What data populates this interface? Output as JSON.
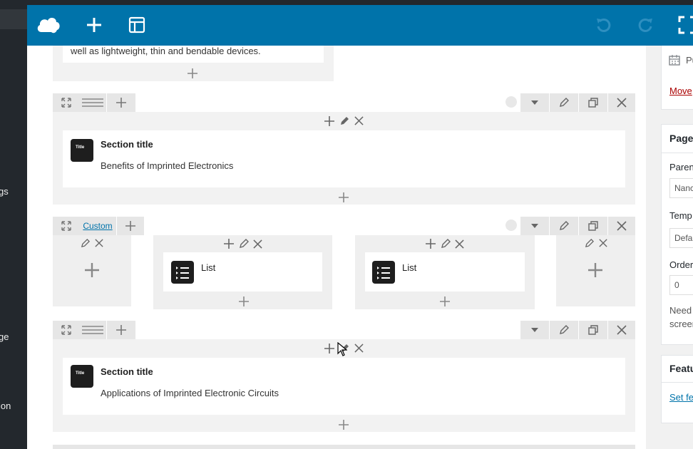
{
  "sidebar": {
    "fragments": [
      "gs",
      "ge",
      "ion"
    ]
  },
  "toolbar": {
    "icons": [
      "logo-cloud-icon",
      "add-icon",
      "layout-icon",
      "undo-icon",
      "redo-icon",
      "fullscreen-icon"
    ]
  },
  "rightpanel": {
    "publish_fragment": "Pu",
    "move_link": "Move",
    "page_heading": "Page",
    "parent_label": "Paren",
    "parent_value": "Nanc",
    "template_label": "Temp",
    "template_value": "Defa",
    "order_label": "Order",
    "order_value": "0",
    "need_text": "Need",
    "screen_text": "screen",
    "featured_heading": "Featu",
    "set_featured_link": "Set fe"
  },
  "rows": {
    "top_text": "well as lightweight, thin and bendable devices.",
    "row1": {
      "element_title": "Section title",
      "element_text": "Benefits of Imprinted Electronics"
    },
    "row2": {
      "layout_label": "Custom",
      "list1_title": "List",
      "list2_title": "List"
    },
    "row3": {
      "element_title": "Section title",
      "element_text": "Applications of Imprinted Electronic Circuits"
    }
  },
  "icon_label": "Title",
  "colors": {
    "toolbar": "#0073aa",
    "wp_sidebar": "#23282d",
    "accent_link": "#0073aa"
  }
}
